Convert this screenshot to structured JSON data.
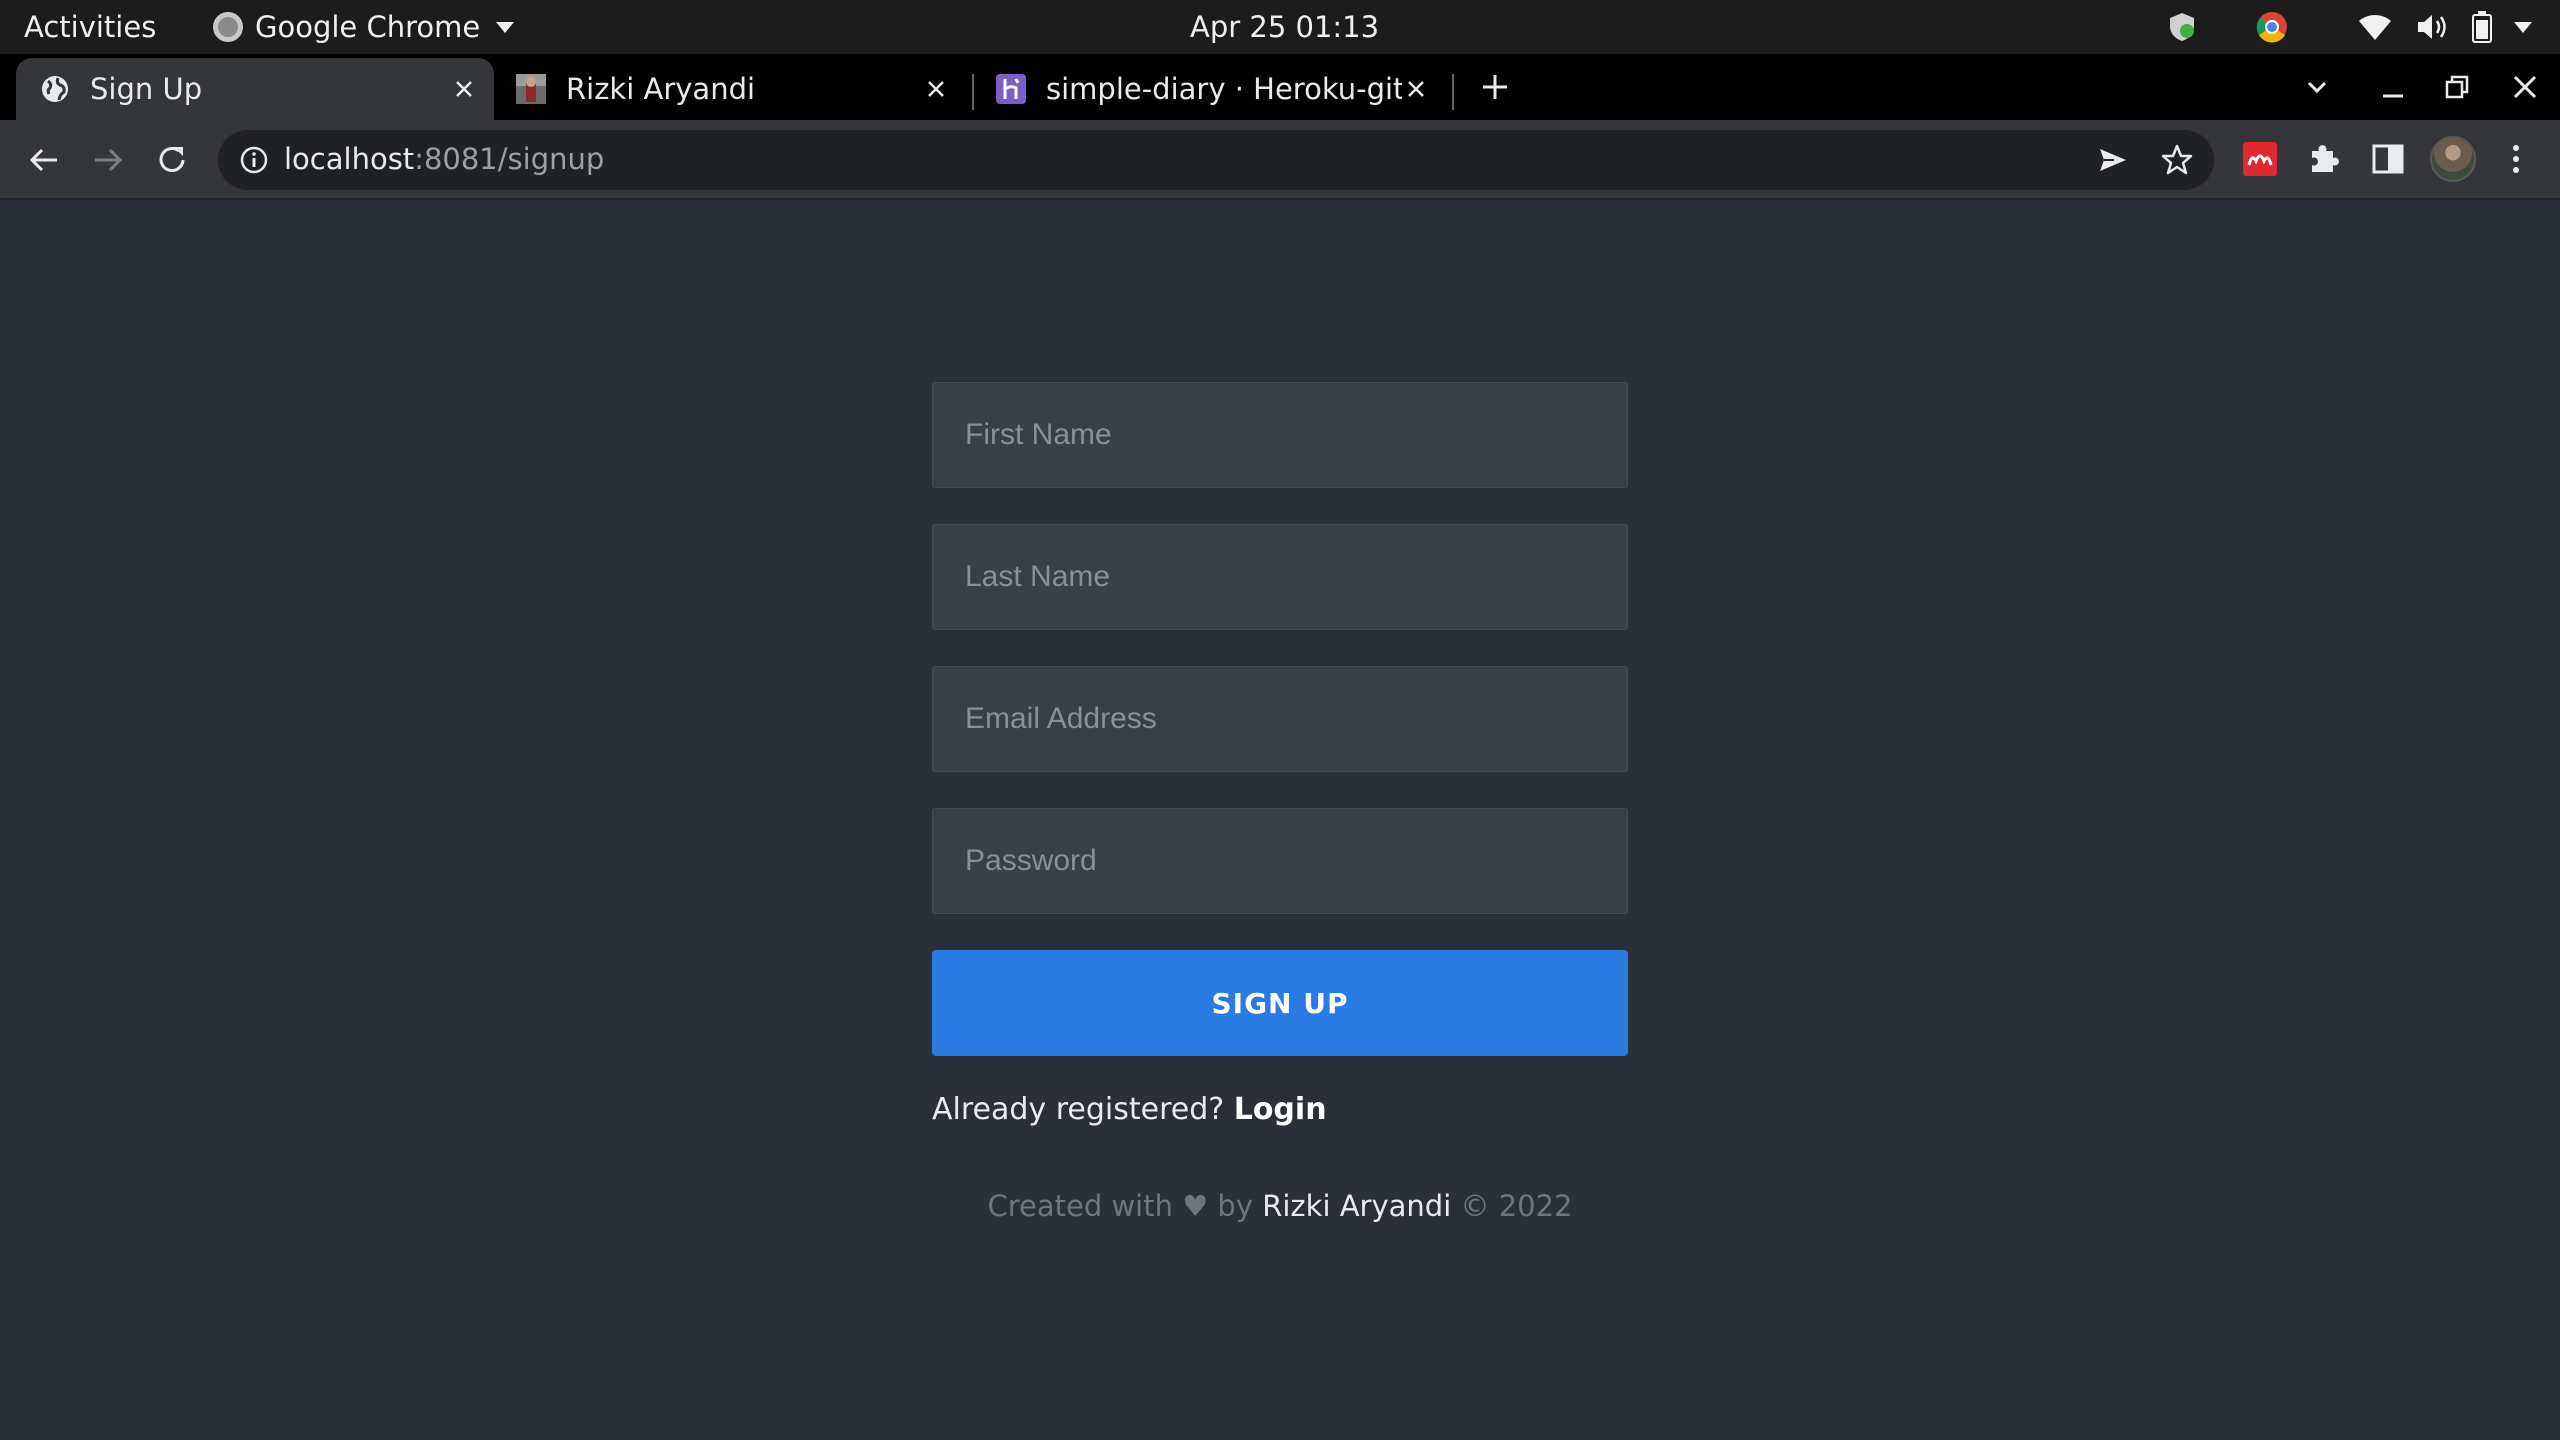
{
  "system_bar": {
    "activities": "Activities",
    "app_name": "Google Chrome",
    "clock": "Apr 25  01:13"
  },
  "tabs": [
    {
      "title": "Sign Up",
      "icon": "globe-icon",
      "active": true
    },
    {
      "title": "Rizki Aryandi",
      "icon": "profile-thumbnail-icon",
      "active": false
    },
    {
      "title": "simple-diary · Heroku-git |",
      "icon": "heroku-icon",
      "active": false
    }
  ],
  "address_bar": {
    "host": "localhost",
    "path": ":8081/signup"
  },
  "form": {
    "first_name_placeholder": "First Name",
    "last_name_placeholder": "Last Name",
    "email_placeholder": "Email Address",
    "password_placeholder": "Password",
    "submit_label": "SIGN UP",
    "already_text": "Already registered? ",
    "login_label": "Login"
  },
  "footer": {
    "prefix": "Created with ♥ by ",
    "author": "Rizki Aryandi",
    "suffix": " © 2022"
  },
  "colors": {
    "page_background": "#2b3038",
    "input_background": "#3a3f47",
    "primary_button": "#2a7ae4"
  }
}
